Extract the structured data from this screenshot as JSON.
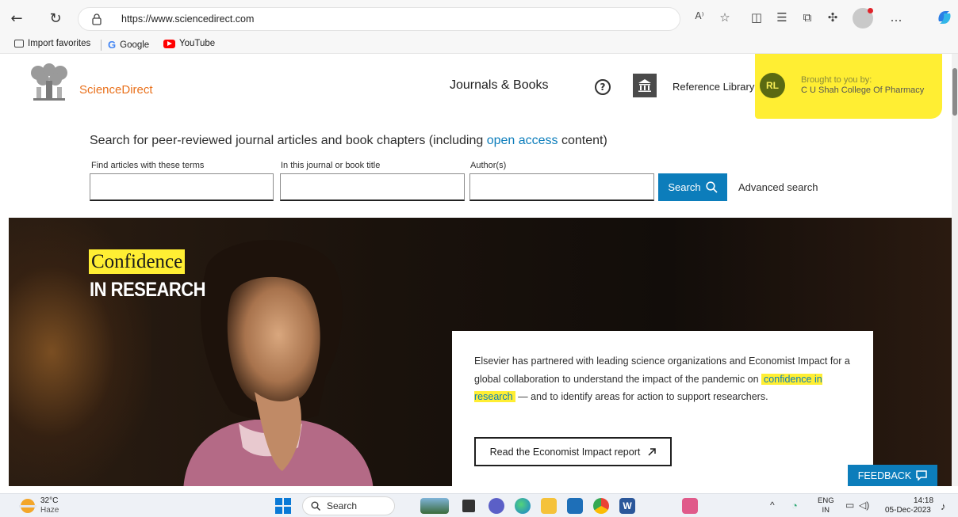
{
  "browser": {
    "url": "https://www.sciencedirect.com",
    "favorites": [
      "Import favorites",
      "Google",
      "YouTube"
    ],
    "read_aloud_label": "A⁾"
  },
  "header": {
    "brand": "ScienceDirect",
    "journals_books": "Journals & Books",
    "help_symbol": "?",
    "reference_library": "Reference Library",
    "avatar_initials": "RL",
    "brought_line1": "Brought to you by:",
    "brought_line2": "C U Shah College Of Pharmacy"
  },
  "search": {
    "heading_before": "Search for peer-reviewed journal articles and book chapters (including ",
    "heading_link": "open access",
    "heading_after": " content)",
    "label_terms": "Find articles with these terms",
    "label_journal": "In this journal or book title",
    "label_author": "Author(s)",
    "button": "Search",
    "advanced": "Advanced search"
  },
  "hero": {
    "title_line1": "Confidence",
    "title_line2": "IN RESEARCH",
    "card_text_before": "Elsevier has partnered with leading science organizations and Economist Impact for a global collaboration to understand the impact of the pandemic on ",
    "card_link": "confidence in research",
    "card_text_after": " — and to identify areas for action to support researchers.",
    "report_button": "Read the Economist Impact report",
    "feedback": "FEEDBACK"
  },
  "taskbar": {
    "temperature": "32°C",
    "weather": "Haze",
    "search_placeholder": "Search",
    "lang_1": "ENG",
    "lang_2": "IN",
    "time": "14:18",
    "date": "05-Dec-2023"
  },
  "colors": {
    "accent_blue": "#0c7dbb",
    "highlight_yellow": "#ffee33",
    "brand_orange": "#e9711c"
  }
}
